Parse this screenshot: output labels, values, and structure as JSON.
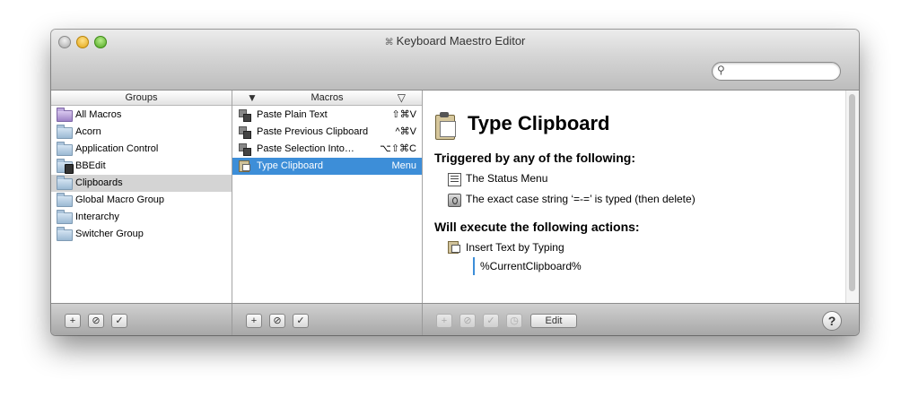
{
  "window": {
    "title": "Keyboard Maestro Editor",
    "search_placeholder": ""
  },
  "groups": {
    "header": "Groups",
    "items": [
      {
        "label": "All Macros",
        "icon": "purple-folder-icon"
      },
      {
        "label": "Acorn",
        "icon": "folder-icon"
      },
      {
        "label": "Application Control",
        "icon": "folder-icon"
      },
      {
        "label": "BBEdit",
        "icon": "bbedit-folder-icon"
      },
      {
        "label": "Clipboards",
        "icon": "folder-icon"
      },
      {
        "label": "Global Macro Group",
        "icon": "folder-icon"
      },
      {
        "label": "Interarchy",
        "icon": "folder-icon"
      },
      {
        "label": "Switcher Group",
        "icon": "folder-icon"
      }
    ],
    "selected": "Clipboards"
  },
  "macros": {
    "header": "Macros",
    "sort_left": "▼",
    "sort_right": "▽",
    "items": [
      {
        "label": "Paste Plain Text",
        "shortcut": "⇧⌘V"
      },
      {
        "label": "Paste Previous Clipboard",
        "shortcut": "^⌘V"
      },
      {
        "label": "Paste Selection Into…",
        "shortcut": "⌥⇧⌘C"
      },
      {
        "label": "Type Clipboard",
        "shortcut": "Menu"
      }
    ],
    "selected": "Type Clipboard"
  },
  "detail": {
    "title": "Type Clipboard",
    "triggers_heading": "Triggered by any of the following:",
    "triggers": [
      "The Status Menu",
      "The exact case string ‘=-=’ is typed (then delete)"
    ],
    "actions_heading": "Will execute the following actions:",
    "action_name": "Insert Text by Typing",
    "action_value": "%CurrentClipboard%"
  },
  "toolbar": {
    "add": "+",
    "disable": "⊘",
    "enable": "✓",
    "clock": "◷",
    "edit_label": "Edit",
    "help": "?"
  },
  "colors": {
    "selection_blue": "#3d8ed8",
    "group_selection": "#d4d4d4"
  }
}
